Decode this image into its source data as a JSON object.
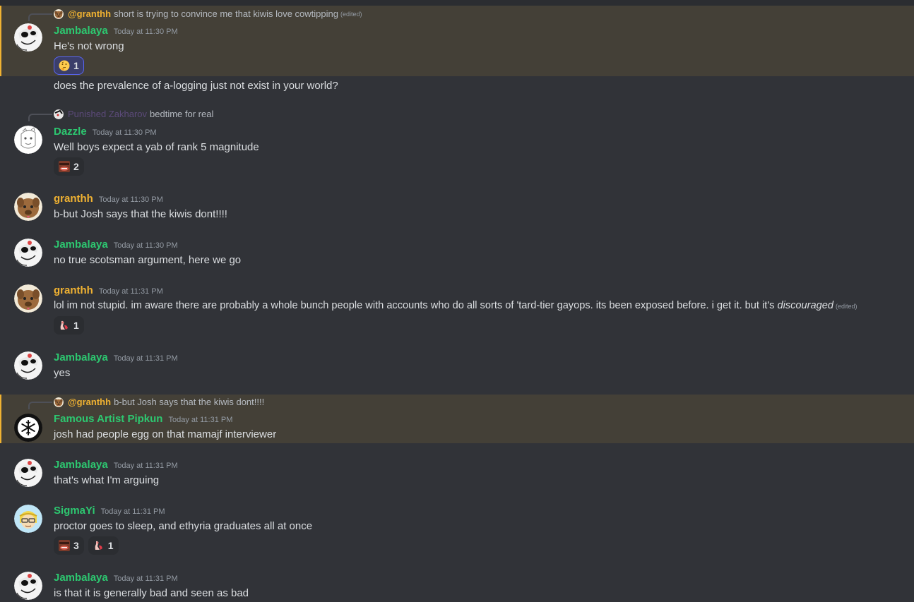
{
  "colors": {
    "green": "#2dc770",
    "gold": "#f0b232",
    "purple": "#5c4a7a",
    "mention_bg": "#444037",
    "bg": "#313338"
  },
  "messages": [
    {
      "reply": {
        "name": "@granthh",
        "text": "short is trying to convince me that kiwis love cowtipping",
        "edited": "(edited)"
      },
      "user": "Jambalaya",
      "time": "Today at 11:30 PM",
      "text": "He's not wrong",
      "react1": {
        "icon": "thinking-face-icon",
        "count": "1"
      }
    },
    {
      "text": "does the prevalence of a-logging just not exist in your world?"
    },
    {
      "reply": {
        "name": "Punished Zakharov",
        "text": "bedtime for real"
      },
      "user": "Dazzle",
      "time": "Today at 11:30 PM",
      "text": "Well boys expect a yab of rank 5 magnitude",
      "react1": {
        "icon": "custom-face-emoji-icon",
        "count": "2"
      }
    },
    {
      "user": "granthh",
      "time": "Today at 11:30 PM",
      "text": "b-but Josh says that the kiwis dont!!!!"
    },
    {
      "user": "Jambalaya",
      "time": "Today at 11:30 PM",
      "text": "no true scotsman argument, here we go"
    },
    {
      "user": "granthh",
      "time": "Today at 11:31 PM",
      "text": "lol im not stupid. im aware there are probably a whole bunch people with accounts who do all sorts of 'tard-tier gayops. its been exposed before. i get it. but it's",
      "text_em": "discouraged",
      "edited": "(edited)",
      "react1": {
        "icon": "custom-pink-emoji-icon",
        "count": "1"
      }
    },
    {
      "user": "Jambalaya",
      "time": "Today at 11:31 PM",
      "text": "yes"
    },
    {
      "reply": {
        "name": "@granthh",
        "text": "b-but Josh says that the kiwis dont!!!!"
      },
      "user": "Famous Artist Pipkun",
      "time": "Today at 11:31 PM",
      "text": "josh had people egg on that mamajf interviewer"
    },
    {
      "user": "Jambalaya",
      "time": "Today at 11:31 PM",
      "text": "that's what I'm arguing"
    },
    {
      "user": "SigmaYi",
      "time": "Today at 11:31 PM",
      "text": "proctor goes to sleep, and ethyria graduates all at once",
      "react1": {
        "icon": "custom-face-emoji-icon",
        "count": "3"
      },
      "react2": {
        "icon": "custom-pink-emoji-icon",
        "count": "1"
      }
    },
    {
      "user": "Jambalaya",
      "time": "Today at 11:31 PM",
      "text": "is that it is generally bad and seen as bad"
    }
  ]
}
